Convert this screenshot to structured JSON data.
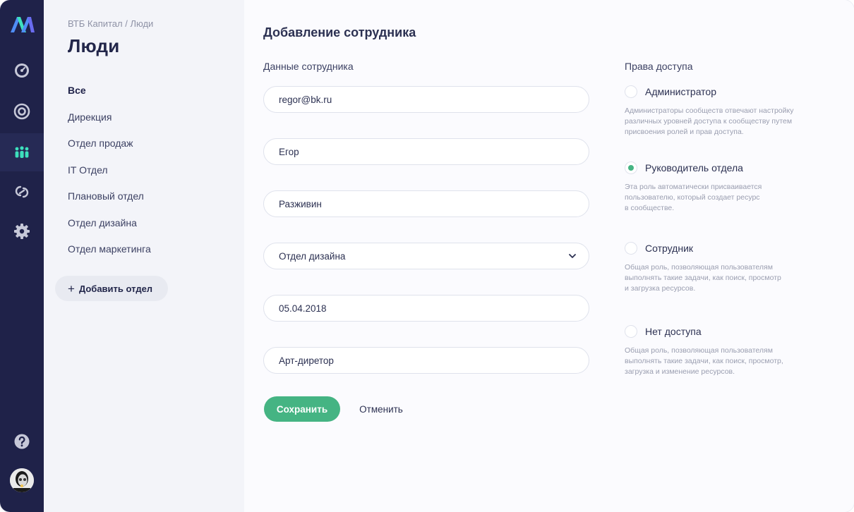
{
  "rail": {
    "items": [
      {
        "icon": "dashboard-gauge-icon",
        "active": false
      },
      {
        "icon": "target-icon",
        "active": false
      },
      {
        "icon": "people-icon",
        "active": true
      },
      {
        "icon": "link-icon",
        "active": false
      },
      {
        "icon": "gear-icon",
        "active": false
      }
    ],
    "help_icon": "question-icon",
    "accent_color": "#3de0bd"
  },
  "sidebar": {
    "breadcrumb": "ВТБ Капитал / Люди",
    "title": "Люди",
    "items": [
      {
        "label": "Все",
        "active": true
      },
      {
        "label": "Дирекция"
      },
      {
        "label": "Отдел продаж"
      },
      {
        "label": "IT Отдел"
      },
      {
        "label": "Плановый отдел"
      },
      {
        "label": "Отдел дизайна"
      },
      {
        "label": "Отдел маркетинга"
      }
    ],
    "add_button": {
      "plus": "+",
      "label": "Добавить отдел"
    }
  },
  "form": {
    "title": "Добавление сотрудника",
    "section_label": "Данные сотрудника",
    "fields": {
      "email": "regor@bk.ru",
      "first_name": "Егор",
      "last_name": "Разживин",
      "department": "Отдел дизайна",
      "date": "05.04.2018",
      "position": "Арт-диретор"
    },
    "save_label": "Сохранить",
    "cancel_label": "Отменить",
    "primary_color": "#45b483"
  },
  "access": {
    "section_label": "Права доступа",
    "roles": [
      {
        "name": "Администратор",
        "checked": false,
        "description": "Администраторы сообществ отвечают настройку\nразличных уровней доступа к сообществу путем\nприсвоения ролей и прав доступа."
      },
      {
        "name": "Руководитель отдела",
        "checked": true,
        "description": "Эта роль автоматически присваивается\nпользователю, который создает ресурс\nв сообществе."
      },
      {
        "name": "Сотрудник",
        "checked": false,
        "description": "Общая роль, позволяющая пользователям\nвыполнять такие задачи, как поиск, просмотр\nи загрузка ресурсов."
      },
      {
        "name": "Нет доступа",
        "checked": false,
        "description": "Общая роль, позволяющая пользователям\nвыполнять такие задачи, как поиск, просмотр,\nзагрузка и изменение ресурсов."
      }
    ]
  }
}
